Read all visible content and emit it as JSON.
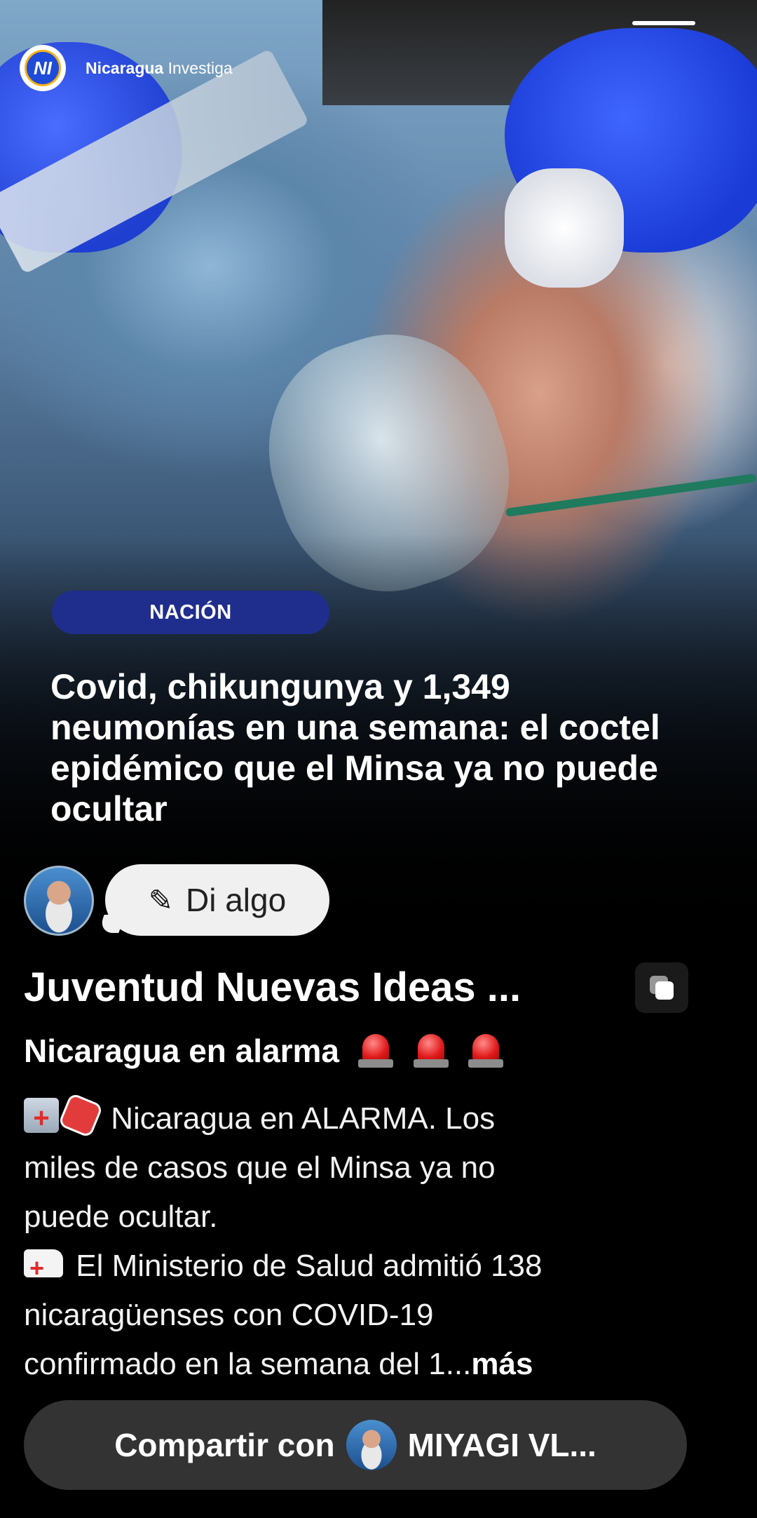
{
  "brand": {
    "name_bold": "Nicaragua",
    "name_rest": " Investiga",
    "logo_letters": "NI"
  },
  "article": {
    "category": "NACIÓN",
    "headline": "Covid, chikungunya y 1,349 neumonías en una semana: el coctel epidémico que el Minsa ya no puede ocultar"
  },
  "comment": {
    "placeholder": "Di algo"
  },
  "post": {
    "author": "Juventud Nuevas Ideas ...",
    "title": "Nicaragua en alarma",
    "body_lines": [
      "Nicaragua en ALARMA. Los",
      "miles de casos que el Minsa ya no",
      "puede ocultar.",
      "El Ministerio de Salud admitió 138",
      "nicaragüenses con COVID-19",
      "confirmado en la semana del 1..."
    ],
    "more_label": "más"
  },
  "share": {
    "prefix": "Compartir con",
    "target": "MIYAGI VL..."
  },
  "icons": {
    "compose": "pencil-icon",
    "copy": "copy-icon",
    "siren": "siren-icon"
  }
}
